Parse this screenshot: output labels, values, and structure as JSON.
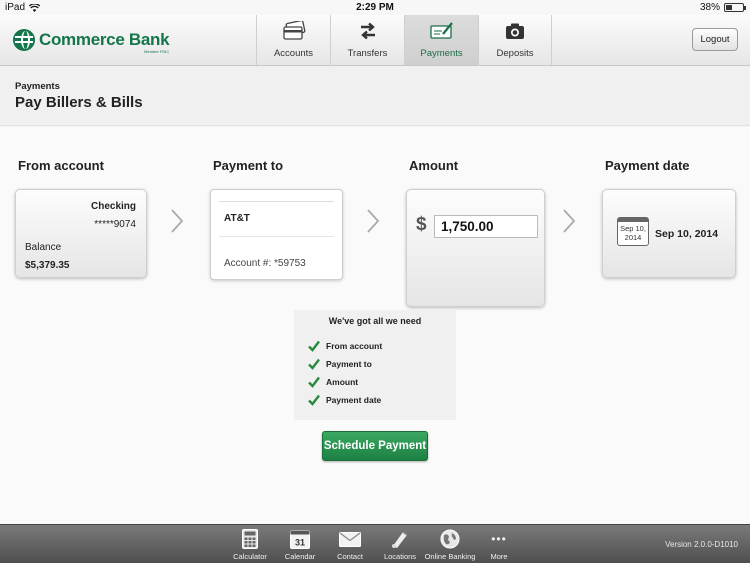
{
  "status_bar": {
    "device": "iPad",
    "time": "2:29 PM",
    "battery": "38%",
    "battery_level": 0.38
  },
  "header": {
    "logo_name": "Commerce Bank",
    "logo_fdic": "Member FDIC",
    "tabs": [
      {
        "label": "Accounts",
        "icon": "credit-card-icon",
        "active": false
      },
      {
        "label": "Transfers",
        "icon": "transfer-arrows-icon",
        "active": false
      },
      {
        "label": "Payments",
        "icon": "check-pen-icon",
        "active": true
      },
      {
        "label": "Deposits",
        "icon": "camera-icon",
        "active": false
      }
    ],
    "logout_label": "Logout"
  },
  "page": {
    "breadcrumb": "Payments",
    "title": "Pay Billers & Bills"
  },
  "from_account": {
    "label": "From account",
    "type": "Checking",
    "number": "*****9074",
    "balance_label": "Balance",
    "balance": "$5,379.35"
  },
  "payment_to": {
    "label": "Payment to",
    "payee": "AT&T",
    "account": "Account #: *59753"
  },
  "amount": {
    "label": "Amount",
    "currency": "$",
    "value": "1,750.00"
  },
  "payment_date": {
    "label": "Payment date",
    "calendar_text": "Sep 10, 2014",
    "date": "Sep 10, 2014"
  },
  "checklist": {
    "heading": "We've got all we need",
    "items": [
      "From account",
      "Payment to",
      "Amount",
      "Payment date"
    ]
  },
  "schedule_button": "Schedule Payment",
  "toolbar": {
    "items": [
      {
        "label": "Calculator",
        "icon": "calculator-icon"
      },
      {
        "label": "Calendar",
        "icon": "calendar-icon",
        "glyph": "31"
      },
      {
        "label": "Contact",
        "icon": "envelope-icon"
      },
      {
        "label": "Locations",
        "icon": "map-pin-icon"
      },
      {
        "label": "Online Banking",
        "icon": "globe-icon"
      },
      {
        "label": "More",
        "icon": "more-dots-icon",
        "glyph": "•••"
      }
    ],
    "version": "Version 2.0.0-D1010"
  },
  "colors": {
    "brand_green": "#14764a",
    "button_green": "#2a9452",
    "check_green": "#2a8a3e"
  }
}
